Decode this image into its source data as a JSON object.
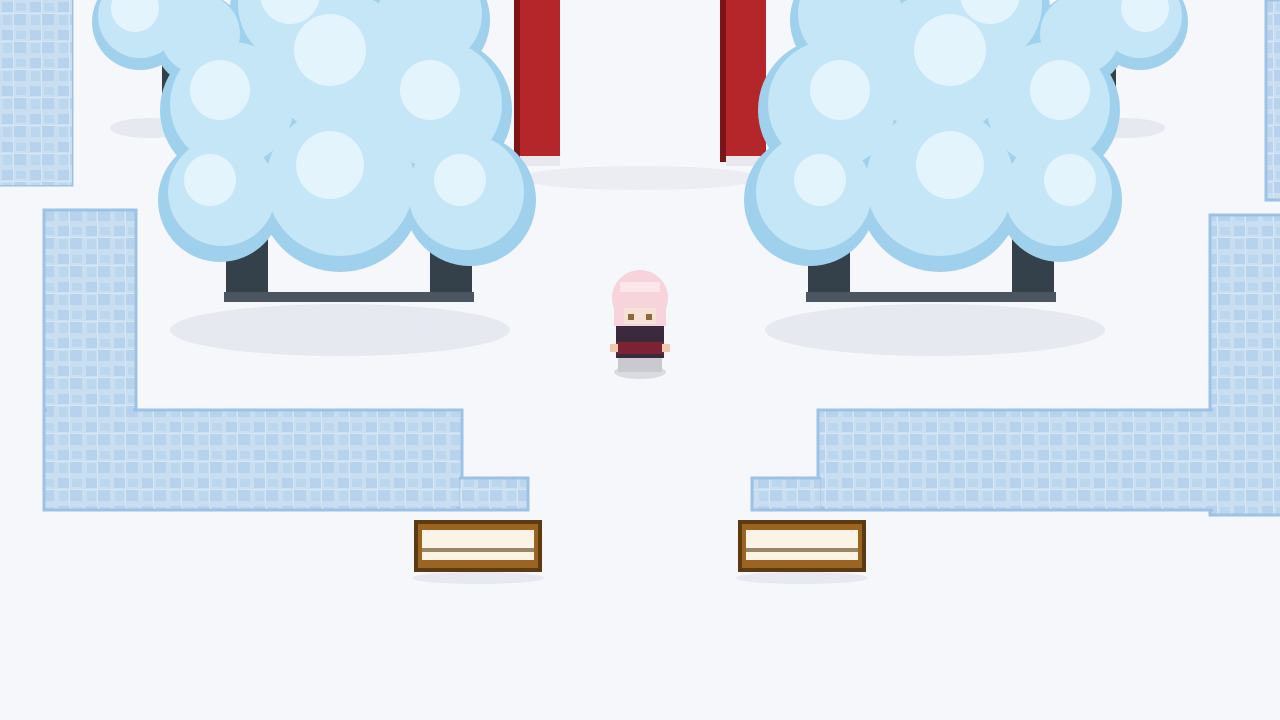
{
  "scene": {
    "type": "top-down pixel-art snowy shrine path",
    "background": "#f6f7fb",
    "shadow": "#e9ebf2"
  },
  "palette": {
    "snow": "#f6f7fb",
    "ice_fill": "#c9def1",
    "ice_stone": "#b7d2ec",
    "ice_edge": "#9cc2e6",
    "torii_red": "#b5262a",
    "torii_dark": "#7c1517",
    "foliage_light": "#e4f4fc",
    "foliage_mid": "#c4e6f6",
    "foliage_shade": "#9fd0ec",
    "trunk": "#35414a",
    "bench_wood": "#9b6420",
    "bench_dark": "#5c3a12",
    "bench_seat": "#fbf4e6",
    "hair": "#f7d3dc",
    "coat": "#3b2a3d",
    "skirt": "#7a2433"
  },
  "entities": {
    "player": {
      "name": "player",
      "facing": "down"
    },
    "torii_gate": {
      "pillars": 2
    },
    "benches": 2,
    "trees": 4
  }
}
